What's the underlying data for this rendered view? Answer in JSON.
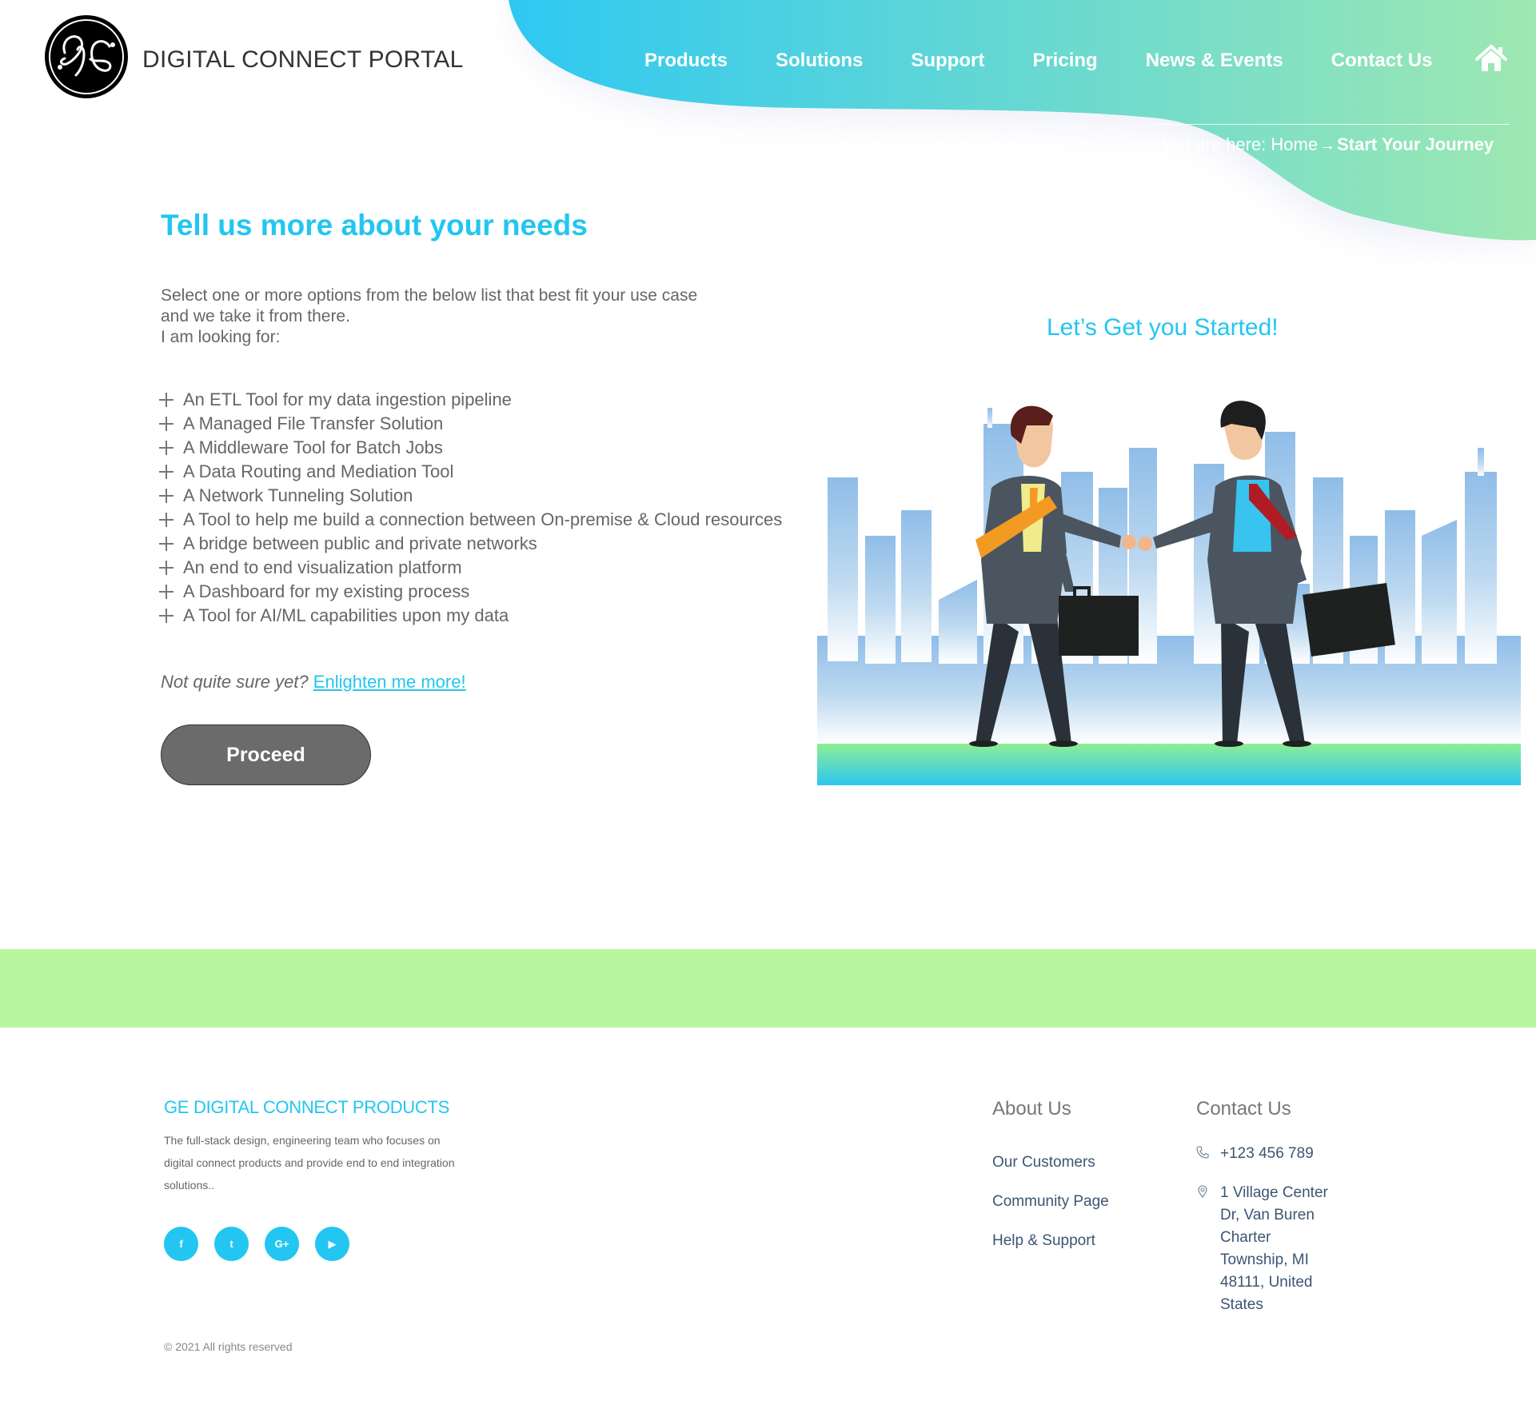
{
  "header": {
    "brand": "DIGITAL CONNECT PORTAL",
    "logo_text": "GE",
    "nav": [
      {
        "label": "Products"
      },
      {
        "label": "Solutions"
      },
      {
        "label": "Support"
      },
      {
        "label": "Pricing"
      },
      {
        "label": "News & Events"
      },
      {
        "label": "Contact Us"
      }
    ],
    "home_icon": "home-icon",
    "breadcrumb": {
      "prefix": "You are here:",
      "home": "Home",
      "separator": "→",
      "current": "Start Your Journey"
    }
  },
  "main": {
    "title": "Tell us more about your needs",
    "intro_lines": [
      "Select one or more options from the below list that best fit your use case",
      "and we take it from there.",
      "I am looking for:"
    ],
    "options": [
      "An ETL Tool for my data ingestion pipeline",
      "A Managed File Transfer Solution",
      "A Middleware Tool for Batch Jobs",
      "A Data Routing and Mediation Tool",
      "A Network Tunneling Solution",
      "A Tool to help me build a connection between On-premise & Cloud resources",
      "A bridge between public and private networks",
      "An end to end visualization platform",
      "A Dashboard for my existing process",
      "A Tool for AI/ML capabilities upon my data"
    ],
    "unsure_question": "Not quite sure yet?",
    "unsure_link": "Enlighten me more!",
    "proceed_label": "Proceed",
    "hero_title": "Let’s Get you Started!"
  },
  "footer": {
    "title": "GE DIGITAL CONNECT PRODUCTS",
    "description": "The full-stack design, engineering team who focuses on digital connect products and provide end to end integration solutions..",
    "socials": [
      {
        "icon": "facebook-icon",
        "glyph": "f"
      },
      {
        "icon": "twitter-icon",
        "glyph": "t"
      },
      {
        "icon": "google-plus-icon",
        "glyph": "G+"
      },
      {
        "icon": "youtube-icon",
        "glyph": "▶"
      }
    ],
    "about_heading": "About Us",
    "about_links": [
      "Our Customers",
      "Community Page",
      "Help & Support"
    ],
    "contact_heading": "Contact Us",
    "phone": "+123 456 789",
    "address": "1 Village Center Dr, Van Buren Charter Township, MI 48111, United States",
    "copyright": "© 2021 All rights reserved"
  },
  "colors": {
    "accent": "#22c6f0",
    "wave_start": "#2ec8f2",
    "wave_end": "#9ee8b2",
    "band": "#b8f7a0",
    "button": "#6b6b6b",
    "link_text": "#3d5573"
  }
}
